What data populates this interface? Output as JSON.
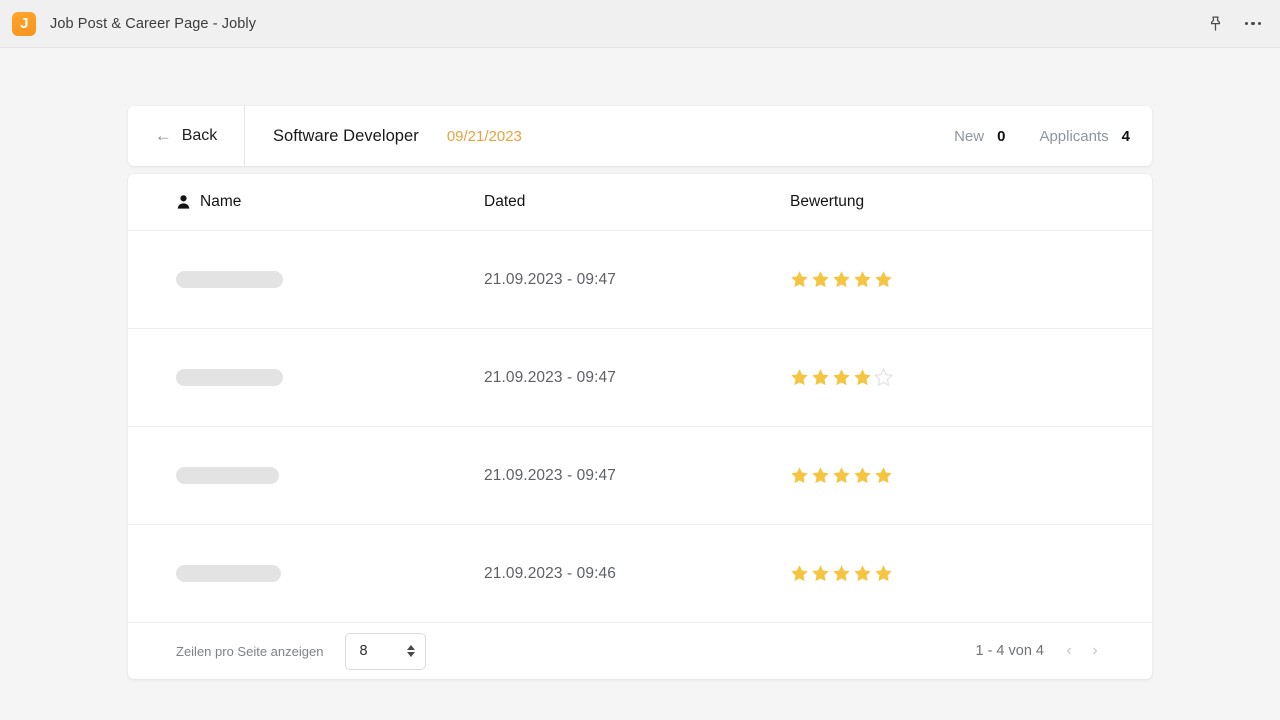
{
  "window": {
    "app_icon": "jobly-app-icon",
    "title": "Job Post & Career Page - Jobly",
    "pin_icon": "pin-icon",
    "more_icon": "more-options-icon"
  },
  "header": {
    "back_label": "Back",
    "back_icon": "arrow-left-icon",
    "job_title": "Software Developer",
    "job_date": "09/21/2023",
    "date_color": "#e8a33d",
    "stats": [
      {
        "label": "New",
        "value": "0"
      },
      {
        "label": "Applicants",
        "value": "4"
      }
    ]
  },
  "table": {
    "name_icon": "person-icon",
    "columns": [
      "Name",
      "Dated",
      "Bewertung"
    ],
    "rows": [
      {
        "name": "",
        "name_width": 107,
        "dated": "21.09.2023 - 09:47",
        "rating": 5,
        "max_rating": 5
      },
      {
        "name": "",
        "name_width": 107,
        "dated": "21.09.2023 - 09:47",
        "rating": 4,
        "max_rating": 5
      },
      {
        "name": "",
        "name_width": 103,
        "dated": "21.09.2023 - 09:47",
        "rating": 5,
        "max_rating": 5
      },
      {
        "name": "",
        "name_width": 105,
        "dated": "21.09.2023 - 09:46",
        "rating": 5,
        "max_rating": 5
      }
    ],
    "star_filled_color": "#f5c542",
    "star_empty_color": "#e4e4e4"
  },
  "footer": {
    "rows_per_page_label": "Zeilen pro Seite anzeigen",
    "rows_per_page_value": "8",
    "rows_per_page_options": [
      "8"
    ],
    "range_text": "1 - 4 von 4",
    "prev_icon": "chevron-left-icon",
    "next_icon": "chevron-right-icon"
  }
}
